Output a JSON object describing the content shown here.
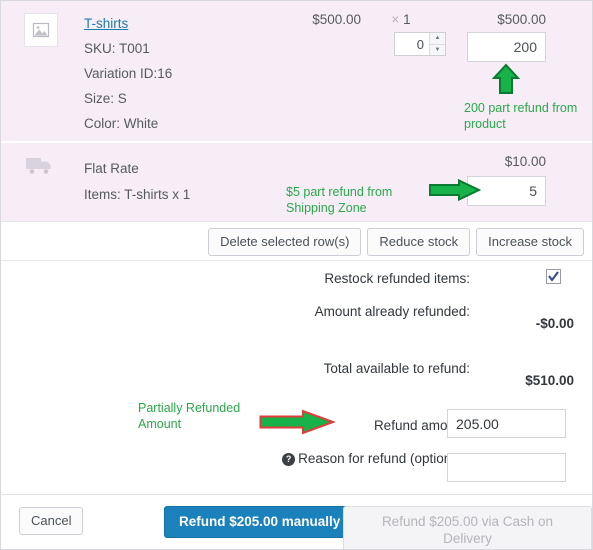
{
  "colors": {
    "row_bg": "#f7edf7",
    "annotation": "#2aa84a",
    "link": "#1f7ca8",
    "primary_button": "#1b81bb"
  },
  "product_row": {
    "name": "T-shirts",
    "sku": "SKU: T001",
    "variation_id": "Variation ID:16",
    "size": "Size:  S",
    "color": "Color: White",
    "unit_total": "$500.00",
    "qty_multiplier": "×",
    "qty": "1",
    "line_total": "$500.00",
    "qty_refund_value": "0",
    "amount_refund_value": "200",
    "thumbnail_icon": "image-placeholder-icon"
  },
  "shipping_row": {
    "method": "Flat Rate",
    "items": "Items: T-shirts x 1",
    "total": "$10.00",
    "refund_value": "5",
    "icon": "truck-icon"
  },
  "annotations": {
    "product": "200 part refund from product",
    "shipping": "$5 part refund from Shipping Zone",
    "refund_amount": "Partially Refunded Amount"
  },
  "stock_actions": {
    "delete_rows": "Delete selected row(s)",
    "reduce_stock": "Reduce stock",
    "increase_stock": "Increase stock"
  },
  "totals": {
    "restock_label": "Restock refunded items:",
    "restock_checked": true,
    "already_refunded_label": "Amount already refunded:",
    "already_refunded_value": "-$0.00",
    "available_label": "Total available to refund:",
    "available_value": "$510.00",
    "refund_amount_label": "Refund amount:",
    "refund_amount_value": "205.00",
    "reason_label": "Reason for refund (optional):",
    "reason_help_icon": "help-icon",
    "reason_value": "",
    "reason_placeholder": ""
  },
  "footer": {
    "cancel": "Cancel",
    "refund_manually": "Refund $205.00 manually",
    "refund_gateway": "Refund $205.00 via Cash on Delivery"
  }
}
